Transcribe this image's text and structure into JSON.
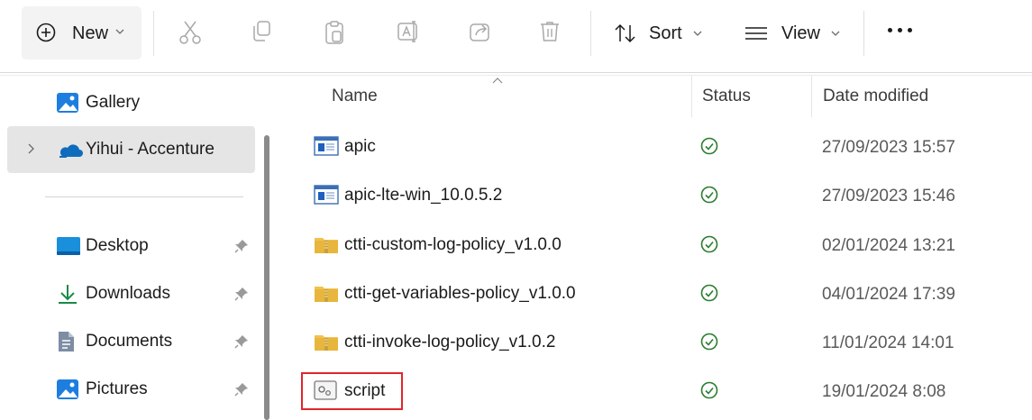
{
  "toolbar": {
    "new_label": "New",
    "sort_label": "Sort",
    "view_label": "View",
    "icons": [
      "plus-circle-icon",
      "cut-icon",
      "copy-icon",
      "paste-icon",
      "rename-icon",
      "share-icon",
      "delete-icon",
      "sort-icon",
      "view-icon",
      "more-icon"
    ]
  },
  "sidebar": {
    "items": [
      {
        "label": "Gallery",
        "icon": "gallery-icon"
      },
      {
        "label": "Yihui - Accenture",
        "icon": "onedrive-icon"
      },
      {
        "label": "Desktop",
        "icon": "desktop-icon"
      },
      {
        "label": "Downloads",
        "icon": "downloads-icon"
      },
      {
        "label": "Documents",
        "icon": "documents-icon"
      },
      {
        "label": "Pictures",
        "icon": "pictures-icon"
      }
    ]
  },
  "columns": {
    "name": "Name",
    "status": "Status",
    "date": "Date modified"
  },
  "files": [
    {
      "name": "apic",
      "type": "app",
      "date": "27/09/2023 15:57"
    },
    {
      "name": "apic-lte-win_10.0.5.2",
      "type": "app",
      "date": "27/09/2023 15:46"
    },
    {
      "name": "ctti-custom-log-policy_v1.0.0",
      "type": "zip",
      "date": "02/01/2024 13:21"
    },
    {
      "name": "ctti-get-variables-policy_v1.0.0",
      "type": "zip",
      "date": "04/01/2024 17:39"
    },
    {
      "name": "ctti-invoke-log-policy_v1.0.2",
      "type": "zip",
      "date": "11/01/2024 14:01"
    },
    {
      "name": "script",
      "type": "script",
      "date": "19/01/2024 8:08"
    }
  ],
  "colors": {
    "accent": "#0078d4",
    "status_green": "#2a7d2e",
    "highlight": "#e0262b",
    "zip_yellow": "#e8b63c"
  }
}
